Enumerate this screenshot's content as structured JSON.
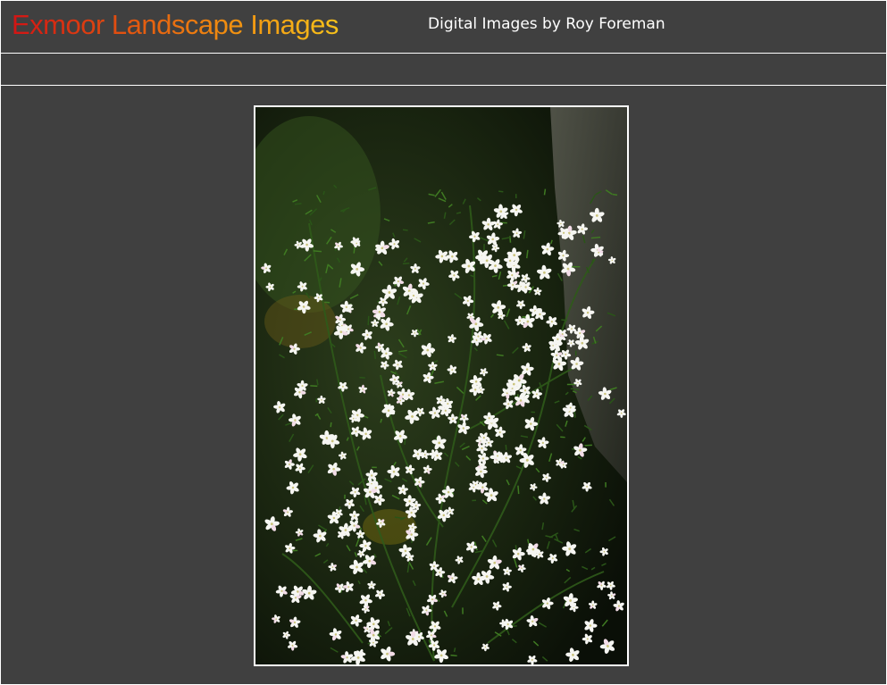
{
  "header": {
    "title": "Exmoor Landscape Images",
    "subtitle": "Digital Images by Roy Foreman"
  },
  "navbar": {
    "items": []
  },
  "main": {
    "photo": {
      "subject": "flower-photo"
    }
  },
  "colors": {
    "background": "#404040",
    "title_gradient_start": "#d21414",
    "title_gradient_end": "#f8c21a",
    "subtitle": "#ffffff",
    "frame_border": "#ffffff"
  }
}
